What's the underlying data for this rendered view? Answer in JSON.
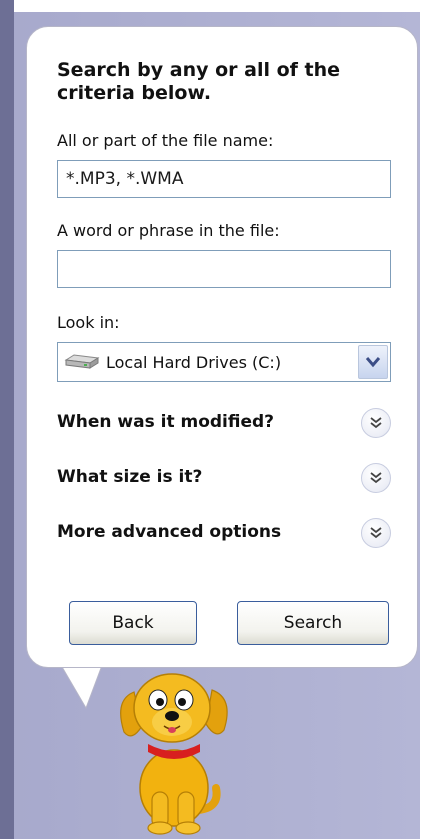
{
  "assistant": {
    "heading": "Search by any or all of the criteria below.",
    "filename": {
      "label": "All or part of the file name:",
      "value": "*.MP3, *.WMA"
    },
    "phrase": {
      "label": "A word or phrase in the file:",
      "value": ""
    },
    "look_in": {
      "label": "Look in:",
      "selected": "Local Hard Drives (C:)"
    },
    "sections": [
      {
        "label": "When was it modified?"
      },
      {
        "label": "What size is it?"
      },
      {
        "label": "More advanced options"
      }
    ],
    "back_label": "Back",
    "search_label": "Search"
  },
  "icons": {
    "drive": "hard-drive-icon",
    "dropdown": "chevron-down-icon",
    "expand": "double-chevron-down-icon",
    "mascot": "search-dog-mascot"
  },
  "colors": {
    "panel_background": "#a9abcd",
    "balloon": "#ffffff",
    "input_border": "#7f9db9",
    "button_border": "#3a5d9c",
    "dog": "#f2b20f",
    "collar": "#d81f1f"
  }
}
